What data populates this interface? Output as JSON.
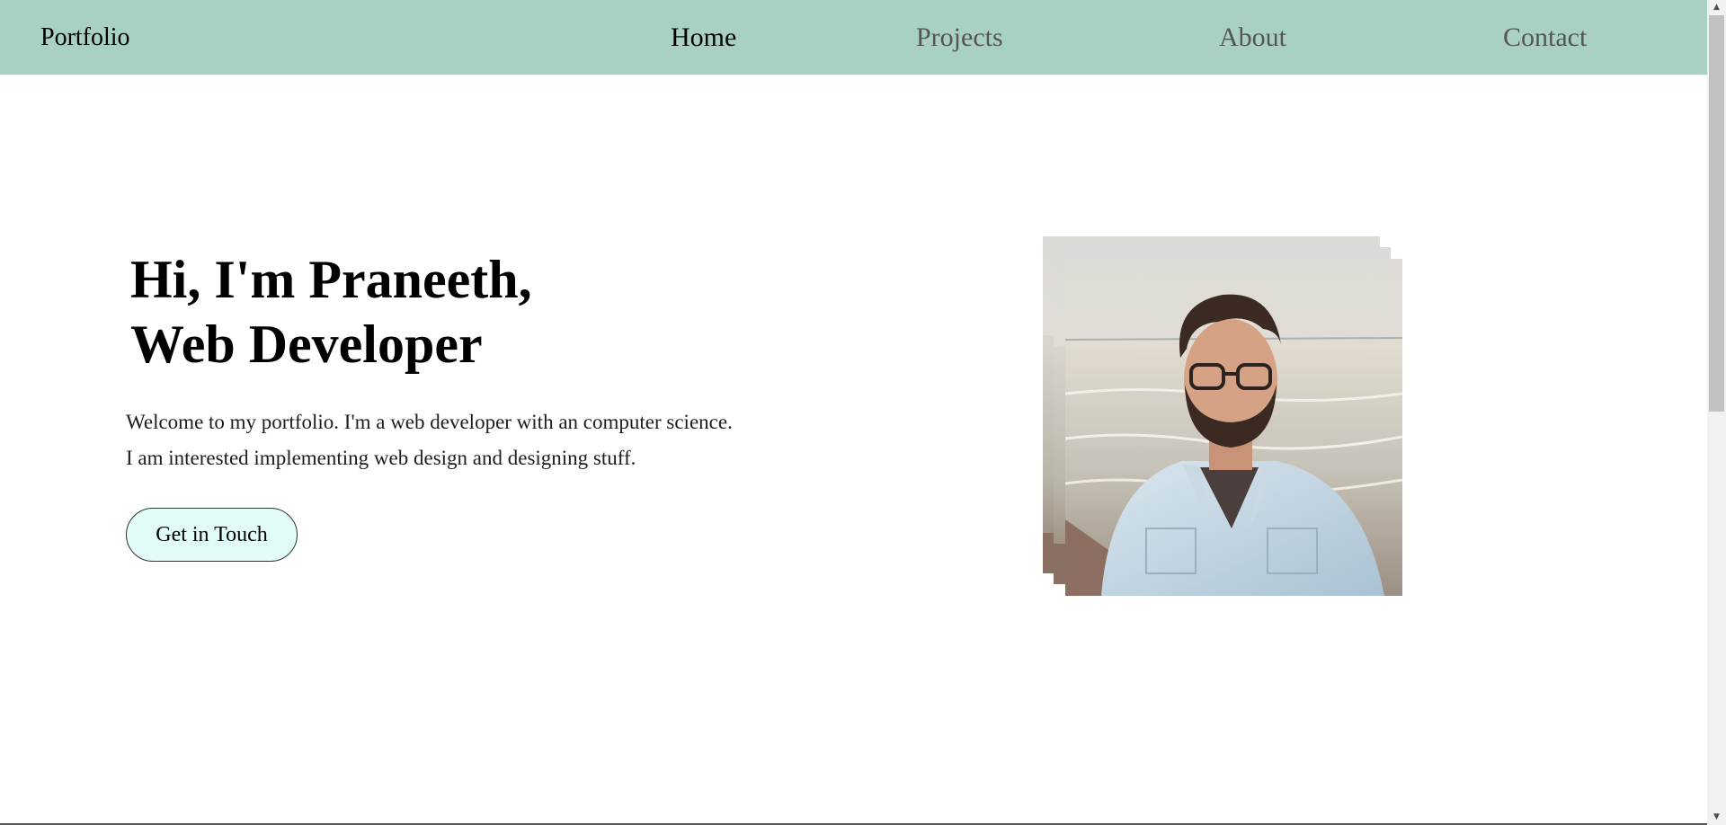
{
  "navbar": {
    "brand": "Portfolio",
    "links": [
      {
        "label": "Home",
        "active": true
      },
      {
        "label": "Projects",
        "active": false
      },
      {
        "label": "About",
        "active": false
      },
      {
        "label": "Contact",
        "active": false
      }
    ]
  },
  "hero": {
    "title_line1": "Hi, I'm Praneeth,",
    "title_line2": "Web Developer",
    "description_line1": "Welcome to my portfolio. I'm a web developer with an computer science.",
    "description_line2": "I am interested implementing web design and designing stuff.",
    "cta_label": "Get in Touch"
  },
  "colors": {
    "navbar_bg": "#a9d0c4",
    "cta_bg": "#e0fbf8",
    "inactive_link": "#555555"
  }
}
